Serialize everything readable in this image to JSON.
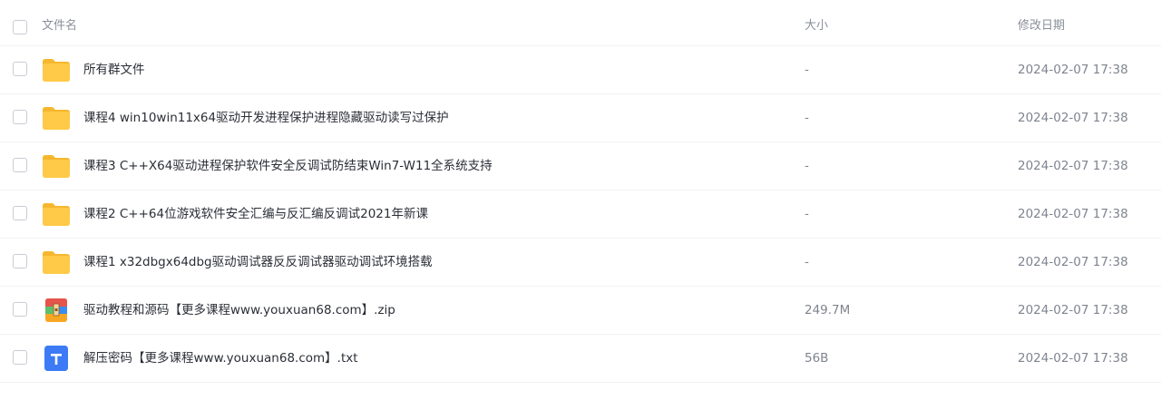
{
  "header": {
    "name_label": "文件名",
    "size_label": "大小",
    "date_label": "修改日期"
  },
  "files": [
    {
      "icon": "folder-icon",
      "name": "所有群文件",
      "size": "-",
      "date": "2024-02-07 17:38"
    },
    {
      "icon": "folder-icon",
      "name": "课程4 win10win11x64驱动开发进程保护进程隐藏驱动读写过保护",
      "size": "-",
      "date": "2024-02-07 17:38"
    },
    {
      "icon": "folder-icon",
      "name": "课程3 C++X64驱动进程保护软件安全反调试防结束Win7-W11全系统支持",
      "size": "-",
      "date": "2024-02-07 17:38"
    },
    {
      "icon": "folder-icon",
      "name": "课程2 C++64位游戏软件安全汇编与反汇编反调试2021年新课",
      "size": "-",
      "date": "2024-02-07 17:38"
    },
    {
      "icon": "folder-icon",
      "name": "课程1 x32dbgx64dbg驱动调试器反反调试器驱动调试环境搭载",
      "size": "-",
      "date": "2024-02-07 17:38"
    },
    {
      "icon": "zip-archive-icon",
      "name": "驱动教程和源码【更多课程www.youxuan68.com】.zip",
      "size": "249.7M",
      "date": "2024-02-07 17:38"
    },
    {
      "icon": "text-file-icon",
      "name": "解压密码【更多课程www.youxuan68.com】.txt",
      "size": "56B",
      "date": "2024-02-07 17:38"
    }
  ],
  "colors": {
    "folder": "#FFCA47",
    "folder_back": "#F5B72E",
    "zip_top": "#E5534B",
    "zip_mid_green": "#5CBF6A",
    "zip_mid_blue": "#3B8CF0",
    "zip_bottom": "#F6A623",
    "text_file": "#3C7BF5"
  }
}
